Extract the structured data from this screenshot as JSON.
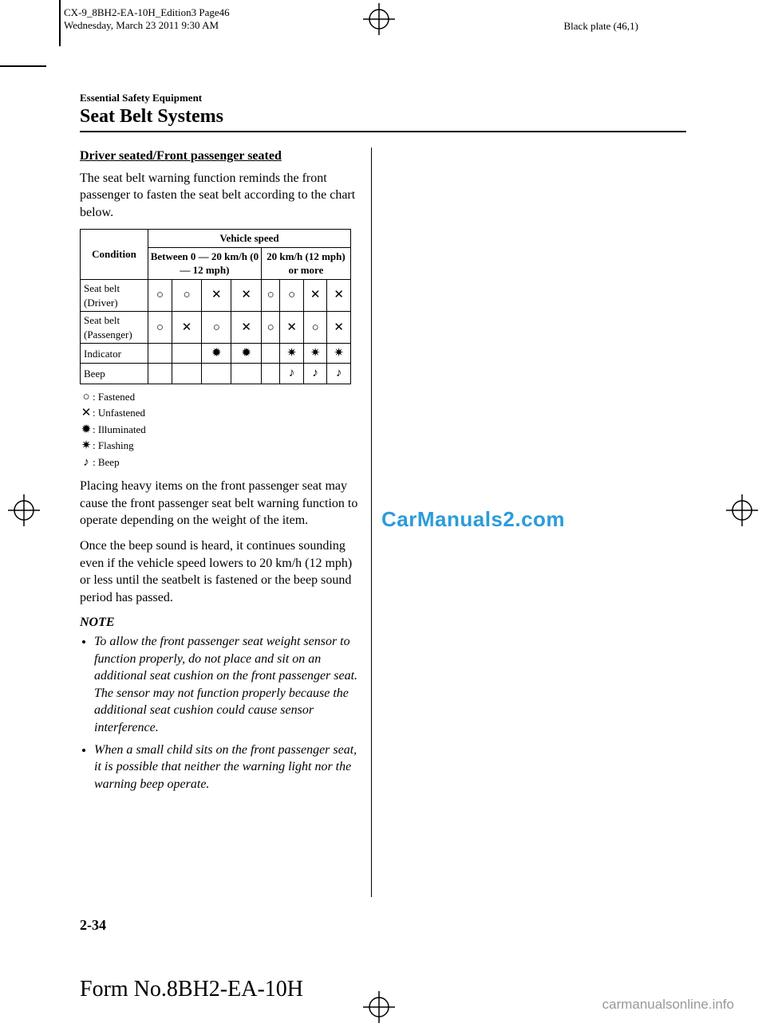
{
  "print_header_line1": "CX-9_8BH2-EA-10H_Edition3 Page46",
  "print_header_line2": "Wednesday, March 23 2011 9:30 AM",
  "black_plate": "Black plate (46,1)",
  "chapter_label": "Essential Safety Equipment",
  "chapter_title": "Seat Belt Systems",
  "subheading": "Driver seated/Front passenger seated",
  "intro_para": "The seat belt warning function reminds the front passenger to fasten the seat belt according to the chart below.",
  "watermark": "CarManuals2.com",
  "chart_data": {
    "type": "table",
    "header_top": "Vehicle speed",
    "col_condition": "Condition",
    "col_speed1": "Between 0 ― 20 km/h (0 ― 12 mph)",
    "col_speed2": "20 km/h (12 mph) or more",
    "rows": [
      {
        "label": "Seat belt (Driver)",
        "cells": [
          "○",
          "○",
          "✕",
          "✕",
          "○",
          "○",
          "✕",
          "✕"
        ]
      },
      {
        "label": "Seat belt (Passenger)",
        "cells": [
          "○",
          "✕",
          "○",
          "✕",
          "○",
          "✕",
          "○",
          "✕"
        ]
      },
      {
        "label": "Indicator",
        "cells": [
          "",
          "",
          "✹",
          "✹",
          "",
          "✷",
          "✷",
          "✷"
        ]
      },
      {
        "label": "Beep",
        "cells": [
          "",
          "",
          "",
          "",
          "",
          "♪",
          "♪",
          "♪"
        ]
      }
    ]
  },
  "legend": {
    "fastened": {
      "sym": "○",
      "text": ": Fastened"
    },
    "unfastened": {
      "sym": "✕",
      "text": ": Unfastened"
    },
    "illum": {
      "sym": "✹",
      "text": ": Illuminated"
    },
    "flash": {
      "sym": "✷",
      "text": ": Flashing"
    },
    "beep": {
      "sym": "♪",
      "text": ": Beep"
    }
  },
  "para_heavy": "Placing heavy items on the front passenger seat may cause the front passenger seat belt warning function to operate depending on the weight of the item.",
  "para_beep": "Once the beep sound is heard, it continues sounding even if the vehicle speed lowers to 20 km/h (12 mph) or less until the seatbelt is fastened or the beep sound period has passed.",
  "note_head": "NOTE",
  "note1": "To allow the front passenger seat weight sensor to function properly, do not place and sit on an additional seat cushion on the front passenger seat. The sensor may not function properly because the additional seat cushion could cause sensor interference.",
  "note2": "When a small child sits on the front passenger seat, it is possible that neither the warning light nor the warning beep operate.",
  "page_num": "2-34",
  "form_no": "Form No.8BH2-EA-10H",
  "footer_link": "carmanualsonline.info"
}
